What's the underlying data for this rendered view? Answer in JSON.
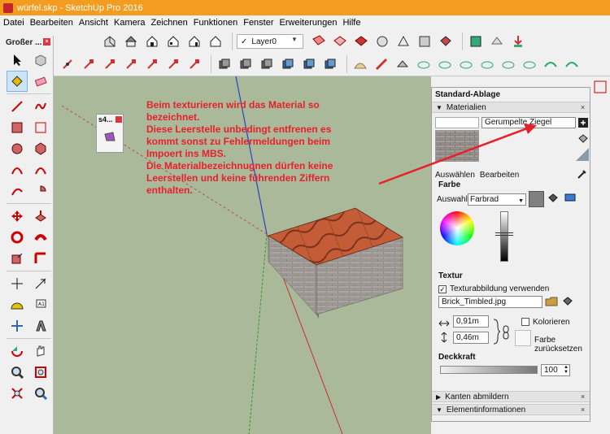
{
  "window": {
    "title": "würfel.skp - SketchUp Pro 2016"
  },
  "menu": [
    "Datei",
    "Bearbeiten",
    "Ansicht",
    "Kamera",
    "Zeichnen",
    "Funktionen",
    "Fenster",
    "Erweiterungen",
    "Hilfe"
  ],
  "layer": {
    "value": "Layer0"
  },
  "toolset": {
    "title": "Großer ..."
  },
  "small_window": {
    "title": "s4..."
  },
  "annotation": {
    "lines": [
      "Beim texturieren wird das Material so",
      "bezeichnet.",
      "Diese Leerstelle unbedingt entfrenen es",
      "kommt sonst zu Fehlermeldungen beim",
      "Impoert ins MBS.",
      "Die Materialbezeichnugnen dürfen keine",
      "Leerstellen und keine führenden Ziffern",
      "enthalten."
    ]
  },
  "tray": {
    "title": "Standard-Ablage",
    "materials": {
      "header": "Materialien",
      "name": "Gerumpelte Ziegel",
      "tabs": [
        "Auswählen",
        "Bearbeiten"
      ],
      "farbe": "Farbe",
      "auswahl_label": "Auswahl:",
      "auswahl_value": "Farbrad",
      "swatch_color": "#808080",
      "textur": "Textur",
      "texture_mapping": "Texturabbildung verwenden",
      "texture_file": "Brick_Timbled.jpg",
      "width": "0,91m",
      "height": "0,46m",
      "colorize": "Kolorieren",
      "reset": "Farbe zurücksetzen",
      "opacity_label": "Deckkraft",
      "opacity_value": "100"
    },
    "sections": [
      "Kanten abmildern",
      "Elementinformationen"
    ]
  },
  "colors": {
    "titlebar": "#f49c1f",
    "viewport": "#a9b99a",
    "annotation": "#e8202a"
  }
}
